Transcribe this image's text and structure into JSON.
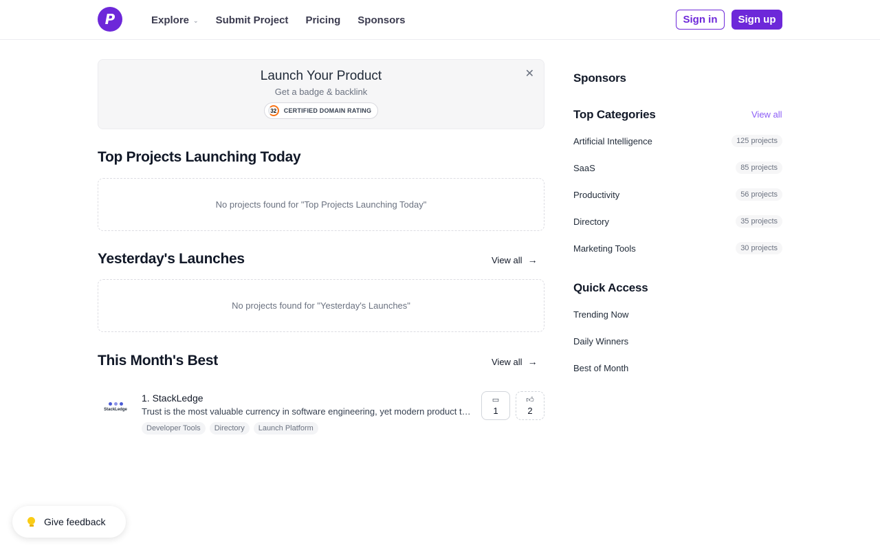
{
  "header": {
    "logo_letter": "P",
    "nav": [
      {
        "label": "Explore",
        "has_dropdown": true
      },
      {
        "label": "Submit Project"
      },
      {
        "label": "Pricing"
      },
      {
        "label": "Sponsors"
      }
    ],
    "sign_in": "Sign in",
    "sign_up": "Sign up",
    "accent_color": "#6d28d9"
  },
  "banner": {
    "title": "Launch Your Product",
    "subtitle": "Get a badge & backlink",
    "badge_number": "32",
    "badge_text": "CERTIFIED DOMAIN RATING",
    "close_icon": "close-icon"
  },
  "sections": {
    "today": {
      "title": "Top Projects Launching Today",
      "empty": "No projects found for \"Top Projects Launching Today\""
    },
    "yesterday": {
      "title": "Yesterday's Launches",
      "view_all": "View all",
      "empty": "No projects found for \"Yesterday's Launches\""
    },
    "month": {
      "title": "This Month's Best",
      "view_all": "View all",
      "projects": [
        {
          "rank_name": "1. StackLedge",
          "logo_text": "StackLedge",
          "description": "Trust is the most valuable currency in software engineering, yet modern product teams struggle to keep it",
          "tags": [
            "Developer Tools",
            "Directory",
            "Launch Platform"
          ],
          "comments": "1",
          "votes": "2"
        }
      ]
    }
  },
  "sidebar": {
    "sponsors_title": "Sponsors",
    "categories_title": "Top Categories",
    "categories_view_all": "View all",
    "categories": [
      {
        "name": "Artificial Intelligence",
        "count": "125 projects"
      },
      {
        "name": "SaaS",
        "count": "85 projects"
      },
      {
        "name": "Productivity",
        "count": "56 projects"
      },
      {
        "name": "Directory",
        "count": "35 projects"
      },
      {
        "name": "Marketing Tools",
        "count": "30 projects"
      }
    ],
    "quick_access_title": "Quick Access",
    "quick_access": [
      "Trending Now",
      "Daily Winners",
      "Best of Month"
    ]
  },
  "feedback": {
    "label": "Give feedback",
    "icon": "lightbulb-icon"
  }
}
